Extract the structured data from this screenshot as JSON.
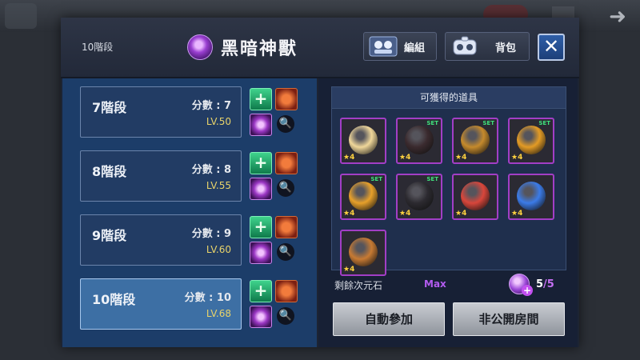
{
  "background": {
    "back_icon": "back-arrow-icon"
  },
  "header": {
    "current_stage": "10階段",
    "title": "黑暗神獸",
    "team_button": "編組",
    "bag_button": "背包",
    "close_label": "✕"
  },
  "stages": [
    {
      "name": "7階段",
      "score": "分數 : 7",
      "level": "LV.50",
      "selected": false
    },
    {
      "name": "8階段",
      "score": "分數 : 8",
      "level": "LV.55",
      "selected": false
    },
    {
      "name": "9階段",
      "score": "分數 : 9",
      "level": "LV.60",
      "selected": false
    },
    {
      "name": "10階段",
      "score": "分數 : 10",
      "level": "LV.68",
      "selected": true
    }
  ],
  "rewards": {
    "title": "可獲得的道具",
    "items": [
      {
        "icon": "blonde-hair-icon",
        "star": "4",
        "set": "",
        "color": "#f0d79a"
      },
      {
        "icon": "black-armor-icon",
        "star": "4",
        "set": "SET",
        "color": "#3a2a2e"
      },
      {
        "icon": "golden-staff-icon",
        "star": "4",
        "set": "SET",
        "color": "#c58a2c"
      },
      {
        "icon": "golden-hook-icon",
        "star": "4",
        "set": "SET",
        "color": "#e39b25"
      },
      {
        "icon": "golden-helmet-icon",
        "star": "4",
        "set": "SET",
        "color": "#e7a02a"
      },
      {
        "icon": "dark-gauntlet-icon",
        "star": "4",
        "set": "SET",
        "color": "#2c2a30"
      },
      {
        "icon": "meat-icon",
        "star": "4",
        "set": "",
        "color": "#d9463b"
      },
      {
        "icon": "blue-crystal-icon",
        "star": "4",
        "set": "",
        "color": "#3b7be8"
      },
      {
        "icon": "fire-shield-icon",
        "star": "4",
        "set": "",
        "color": "#c77a33"
      }
    ]
  },
  "stones": {
    "label": "剩餘次元石",
    "max_label": "Max",
    "current": "5",
    "total": "/5"
  },
  "buttons": {
    "auto_join": "自動參加",
    "private_room": "非公開房間"
  }
}
